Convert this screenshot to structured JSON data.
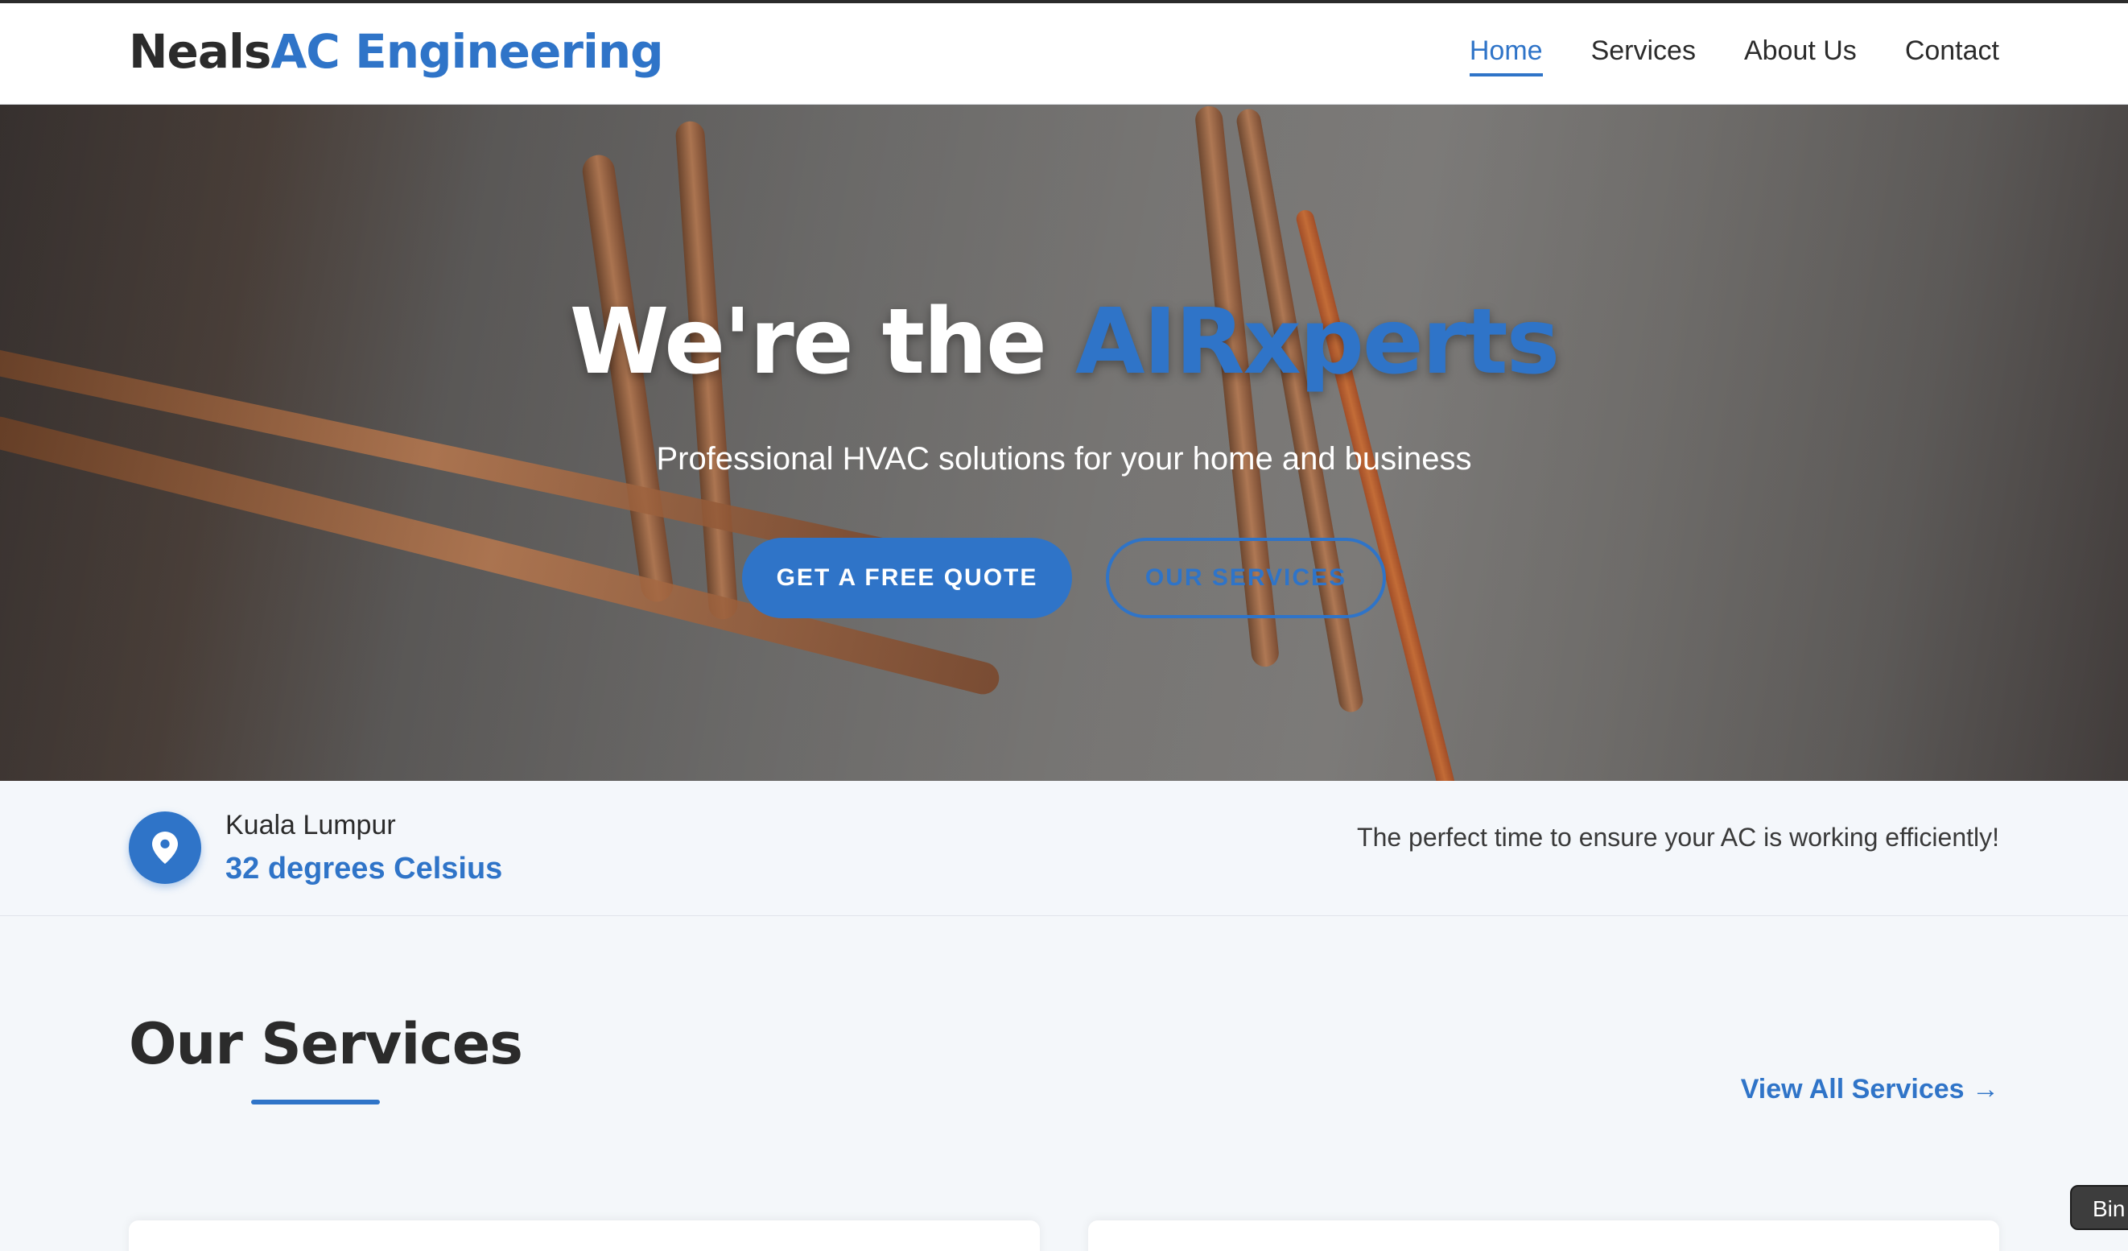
{
  "brand": {
    "name_dark": "Neals",
    "name_blue": "AC Engineering"
  },
  "nav": {
    "items": [
      {
        "label": "Home",
        "active": true
      },
      {
        "label": "Services",
        "active": false
      },
      {
        "label": "About Us",
        "active": false
      },
      {
        "label": "Contact",
        "active": false
      }
    ]
  },
  "hero": {
    "title_prefix": "We're the ",
    "title_accent": "AIRxperts",
    "subtitle": "Professional HVAC solutions for your home and business",
    "primary_button": "GET A FREE QUOTE",
    "secondary_button": "OUR SERVICES"
  },
  "weather": {
    "city": "Kuala Lumpur",
    "temperature": "32 degrees Celsius",
    "tip": "The perfect time to ensure your AC is working efficiently!",
    "icon": "location-pin-icon"
  },
  "services": {
    "title": "Our Services",
    "view_all": "View All Services →"
  },
  "floating_tag": {
    "label": "Bin"
  },
  "colors": {
    "accent": "#2f74c8",
    "text": "#2b2b2b",
    "background": "#f4f7fa"
  }
}
